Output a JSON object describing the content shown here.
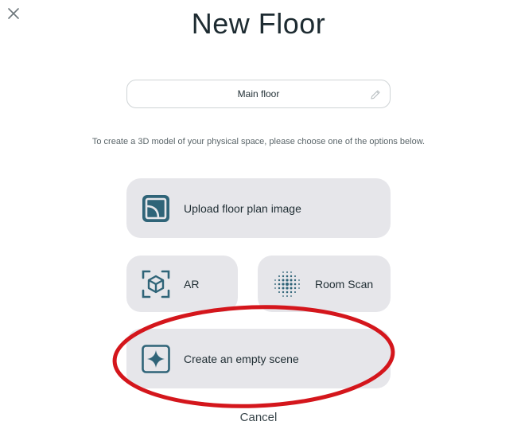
{
  "dialog": {
    "title": "New Floor",
    "close_icon": "close-icon"
  },
  "floor_name": {
    "value": "Main floor",
    "edit_icon": "pencil-icon"
  },
  "instruction": "To create a 3D model of your physical space, please choose one of the options below.",
  "options": {
    "upload": {
      "label": "Upload floor plan image",
      "icon": "floor-plan-icon"
    },
    "ar": {
      "label": "AR",
      "icon": "ar-cube-icon"
    },
    "room_scan": {
      "label": "Room Scan",
      "icon": "dot-grid-scan-icon"
    },
    "empty_scene": {
      "label": "Create an empty scene",
      "icon": "sparkle-icon"
    }
  },
  "cancel_label": "Cancel",
  "colors": {
    "accent": "#2f6478",
    "option_bg": "#e6e6ea",
    "highlight": "#d4161c"
  }
}
